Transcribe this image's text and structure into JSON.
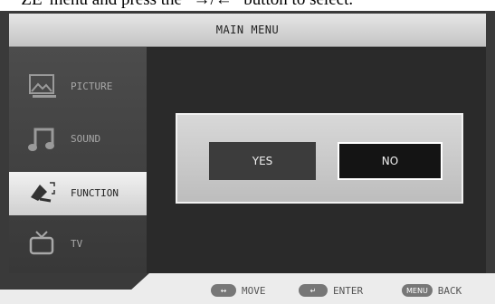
{
  "caption_fragment": "'ZE' menu and press the \"→/←\" button to select.",
  "title": "MAIN MENU",
  "sidebar": {
    "items": [
      {
        "label": "PICTURE",
        "icon": "picture-icon",
        "active": false
      },
      {
        "label": "SOUND",
        "icon": "music-note-icon",
        "active": false
      },
      {
        "label": "FUNCTION",
        "icon": "function-tool-icon",
        "active": true
      },
      {
        "label": "TV",
        "icon": "tv-icon",
        "active": false
      }
    ]
  },
  "dialog": {
    "yes_label": "YES",
    "no_label": "NO",
    "selected": "NO"
  },
  "footer": {
    "move": {
      "key": "↔",
      "label": "MOVE"
    },
    "enter": {
      "key": "↵",
      "label": "ENTER"
    },
    "back": {
      "key": "MENU",
      "label": "BACK"
    }
  },
  "colors": {
    "frame": "#3a3a3a",
    "highlight": "#e6e6e6",
    "selected_button": "#141414"
  }
}
